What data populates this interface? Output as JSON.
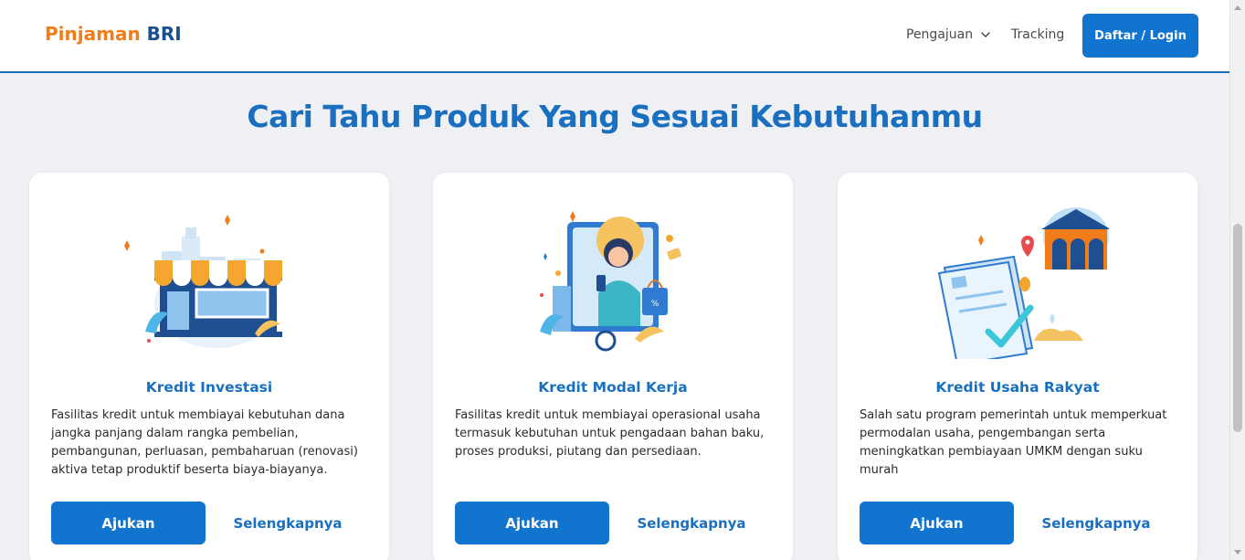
{
  "header": {
    "logo_part1": "Pinjaman",
    "logo_part2": " BRI",
    "nav": [
      {
        "label": "Pengajuan",
        "icon": "chevron-down-icon"
      },
      {
        "label": "Tracking"
      }
    ],
    "login_label": "Daftar / Login"
  },
  "main": {
    "title": "Cari Tahu Produk Yang Sesuai Kebutuhanmu",
    "cards": [
      {
        "title": "Kredit Investasi",
        "description": "Fasilitas kredit untuk membiayai kebutuhan dana jangka panjang dalam rangka pembelian, pembangunan, perluasan, pembaharuan (renovasi) aktiva tetap produktif beserta biaya-biayanya.",
        "apply_label": "Ajukan",
        "more_label": "Selengkapnya",
        "illustration": "shop-illustration"
      },
      {
        "title": "Kredit Modal Kerja",
        "description": "Fasilitas kredit untuk membiayai operasional usaha termasuk kebutuhan untuk pengadaan bahan baku, proses produksi, piutang dan persediaan.",
        "apply_label": "Ajukan",
        "more_label": "Selengkapnya",
        "illustration": "shopper-illustration"
      },
      {
        "title": "Kredit Usaha Rakyat",
        "description": "Salah satu program pemerintah untuk memperkuat permodalan usaha, pengembangan serta meningkatkan pembiayaan UMKM dengan suku murah",
        "apply_label": "Ajukan",
        "more_label": "Selengkapnya",
        "illustration": "bank-document-illustration"
      }
    ]
  },
  "colors": {
    "primary": "#1174cf",
    "title_blue": "#1a6fbf",
    "logo_orange": "#f07d1a",
    "logo_navy": "#1a4f8f",
    "background": "#eef0f4"
  }
}
